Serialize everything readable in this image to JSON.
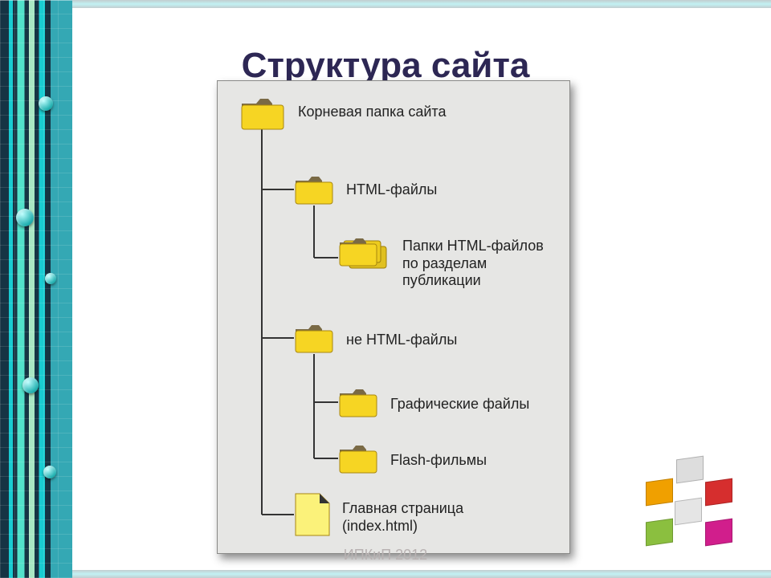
{
  "title": "Структура сайта",
  "footer": "ИПКиП 2012",
  "tree": {
    "root": {
      "label": "Корневая папка сайта"
    },
    "html": {
      "label": "HTML-файлы"
    },
    "sections": {
      "label": "Папки HTML-файлов\nпо разделам\nпубликации"
    },
    "nonhtml": {
      "label": "не HTML-файлы"
    },
    "graphics": {
      "label": "Графические файлы"
    },
    "flash": {
      "label": "Flash-фильмы"
    },
    "index": {
      "label": "Главная страница\n(index.html)"
    }
  }
}
